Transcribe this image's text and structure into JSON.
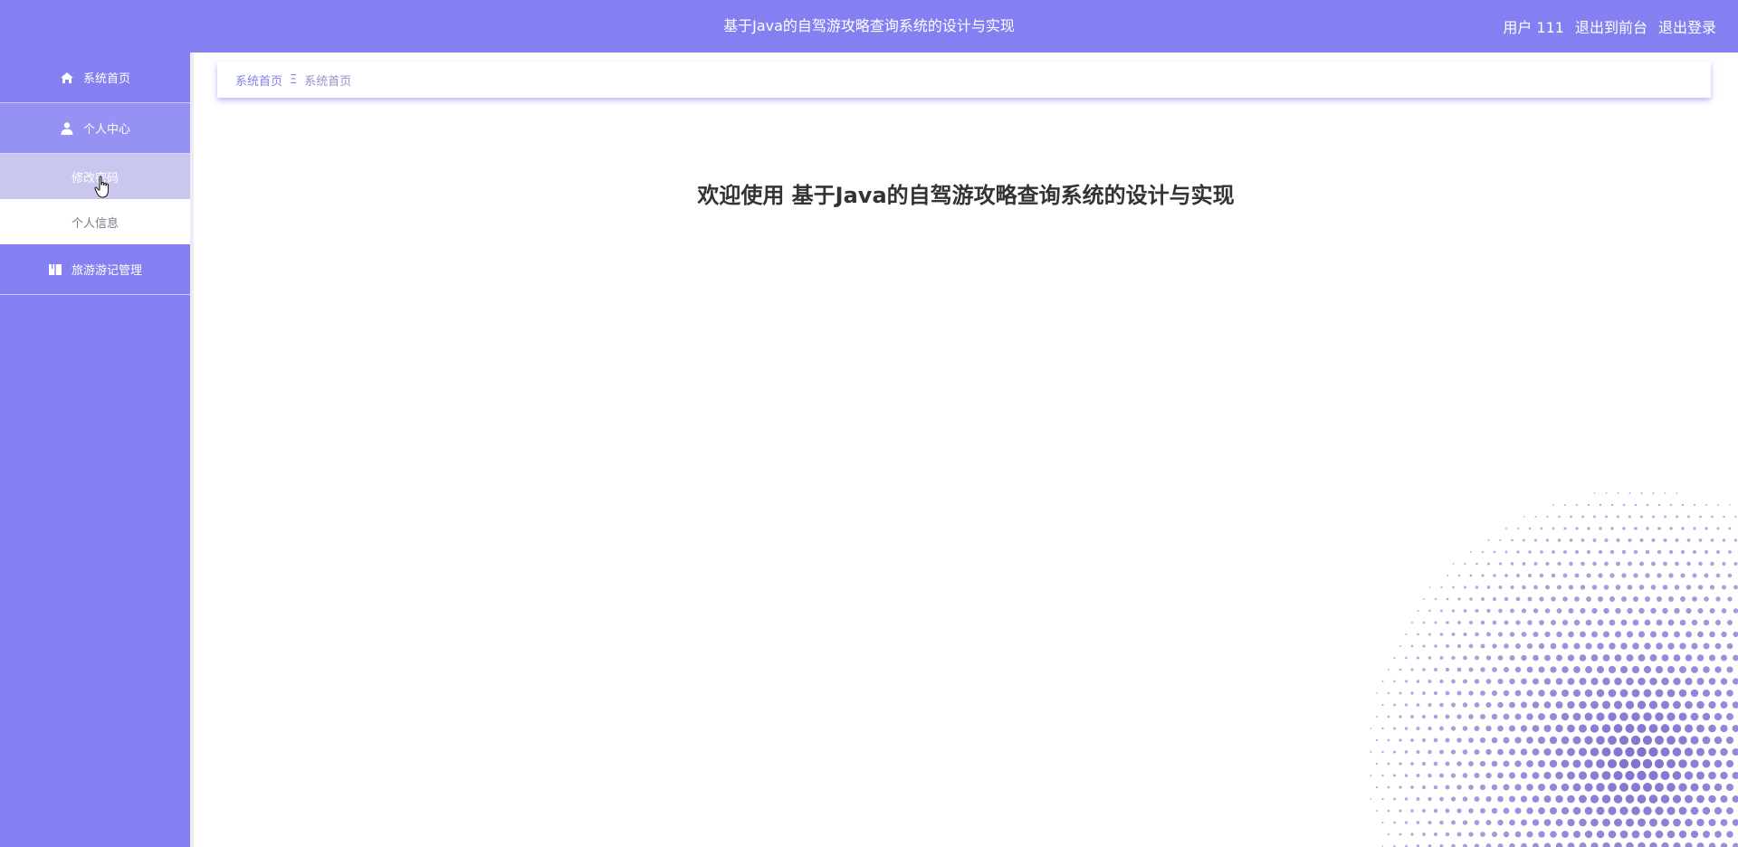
{
  "header": {
    "title": "基于Java的自驾游攻略查询系统的设计与实现",
    "user_label": "用户 111",
    "front_link": "退出到前台",
    "logout_link": "退出登录"
  },
  "sidebar": {
    "items": [
      {
        "label": "系统首页",
        "icon": "home-icon"
      },
      {
        "label": "个人中心",
        "icon": "user-icon",
        "children": [
          {
            "label": "修改密码"
          },
          {
            "label": "个人信息"
          }
        ]
      },
      {
        "label": "旅游游记管理",
        "icon": "book-icon"
      }
    ]
  },
  "breadcrumb": {
    "root": "系统首页",
    "separator": "Ξ",
    "current": "系统首页"
  },
  "main": {
    "welcome": "欢迎使用 基于Java的自驾游攻略查询系统的设计与实现"
  },
  "theme": {
    "accent": "#8480f1",
    "accent_light": "#9592f3",
    "hover_bg": "#cac7ef",
    "dot_color": "#7d73cf"
  }
}
